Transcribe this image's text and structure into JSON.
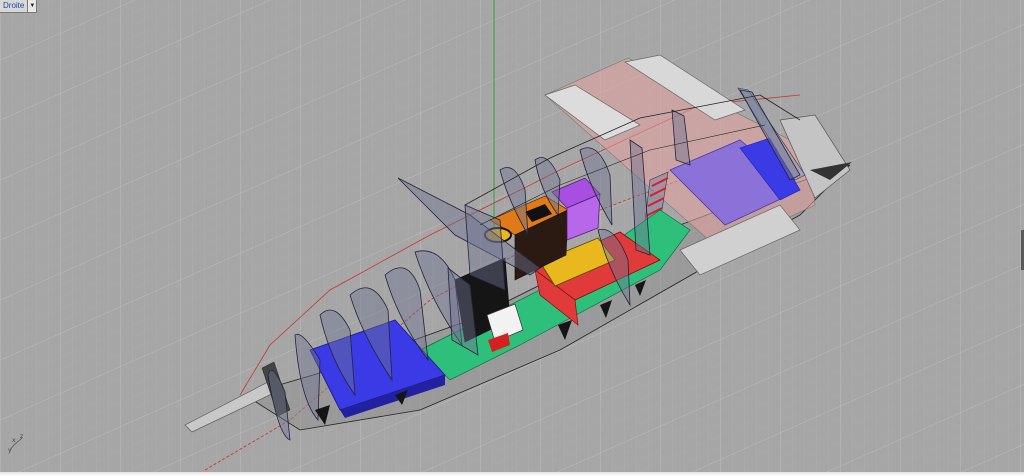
{
  "viewport": {
    "title": "Droite",
    "menu_icon": "triangle-down-icon"
  },
  "axis_labels": {
    "x": "x",
    "y": "y",
    "z": "z"
  },
  "colors": {
    "background": "#a6a6a6",
    "grid": "#b4b4b4",
    "axis_green": "#2aa830",
    "axis_red": "#d43030",
    "berth_blue": "#3a3ae6",
    "floor_green": "#2ec07a",
    "bench_red": "#e03a3a",
    "table_yellow": "#e8b81e",
    "galley_orange": "#e07a18",
    "locker_purple": "#a84ee0",
    "cabin_lavender": "#8a72d8",
    "deck_pink": "#e8a0a0"
  }
}
